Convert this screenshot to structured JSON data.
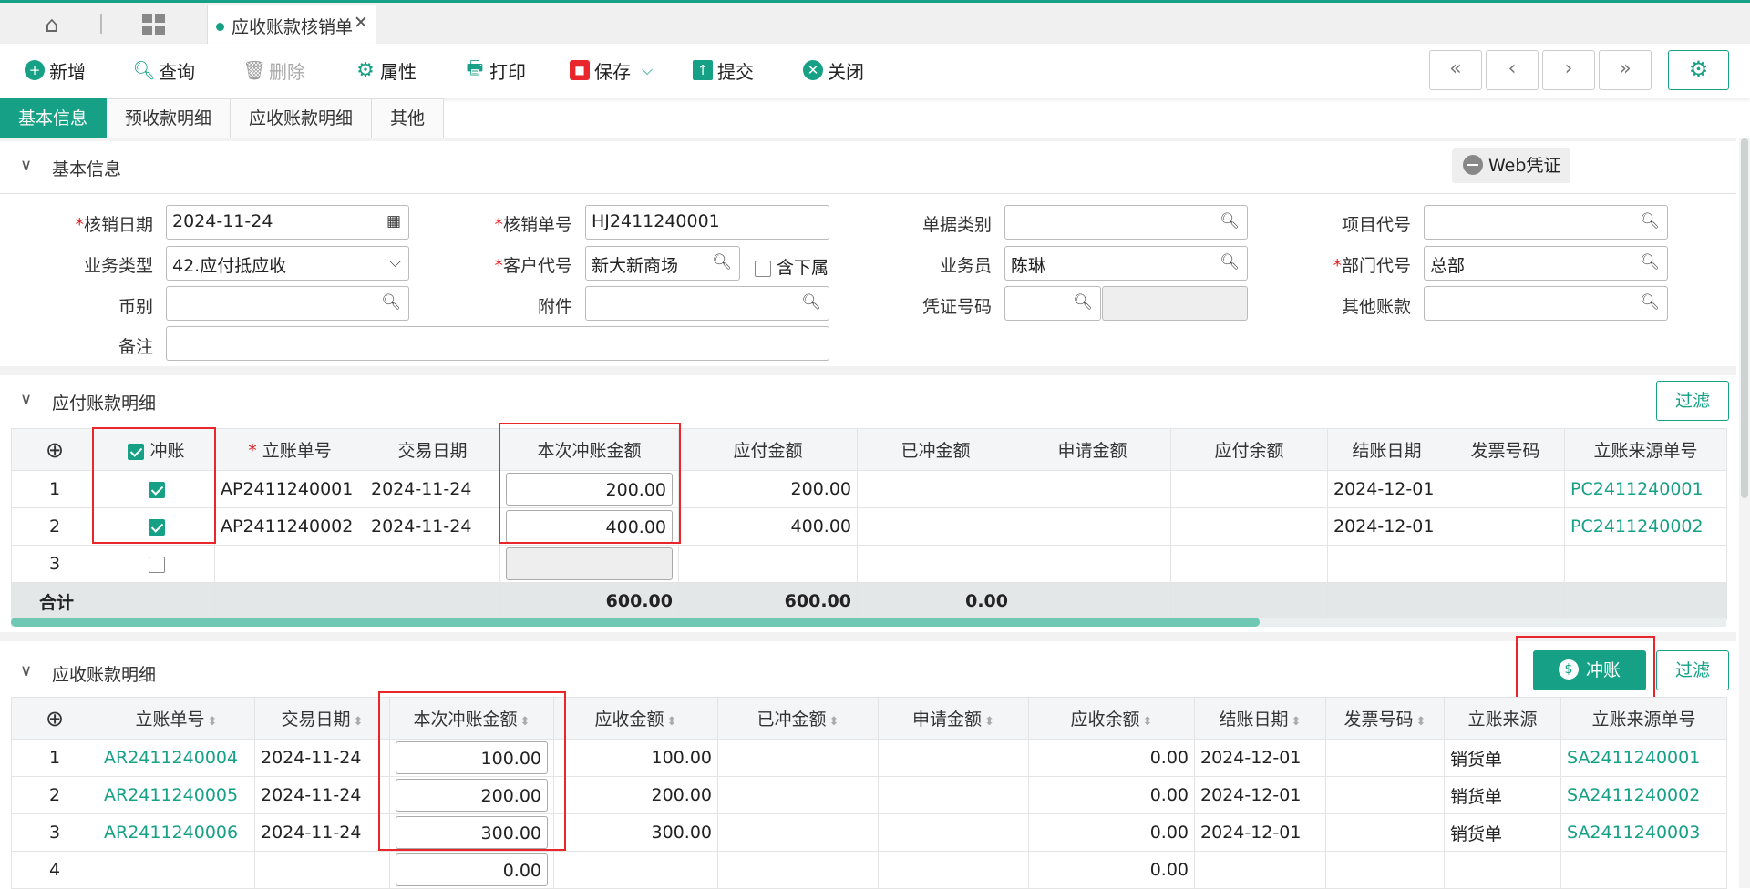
{
  "tabs_bar": {
    "doc_tab_label": "应收账款核销单"
  },
  "toolbar": {
    "new": "新增",
    "query": "查询",
    "delete": "删除",
    "props": "属性",
    "print": "打印",
    "save": "保存",
    "submit": "提交",
    "close": "关闭"
  },
  "nav": {
    "first": "«",
    "prev": "‹",
    "next": "›",
    "last": "»"
  },
  "page_tabs": [
    "基本信息",
    "预收款明细",
    "应收账款明细",
    "其他"
  ],
  "basic": {
    "section_title": "基本信息",
    "web_voucher": "Web凭证",
    "labels": {
      "date": "核销日期",
      "doc_no": "核销单号",
      "doc_type": "单据类别",
      "project": "项目代号",
      "biz_type": "业务类型",
      "customer": "客户代号",
      "include_sub": "含下属",
      "salesman": "业务员",
      "dept": "部门代号",
      "currency": "币别",
      "attachment": "附件",
      "voucher_no": "凭证号码",
      "other_acct": "其他账款",
      "remark": "备注"
    },
    "values": {
      "date": "2024-11-24",
      "doc_no": "HJ2411240001",
      "doc_type": "",
      "project": "",
      "biz_type": "42.应付抵应收",
      "customer": "新大新商场",
      "salesman": "陈琳",
      "dept": "总部",
      "currency": "",
      "attachment": "",
      "voucher_no": "",
      "other_acct": "",
      "remark": ""
    }
  },
  "payable": {
    "section_title": "应付账款明细",
    "filter": "过滤",
    "headers": [
      "冲账",
      "立账单号",
      "交易日期",
      "本次冲账金额",
      "应付金额",
      "已冲金额",
      "申请金额",
      "应付余额",
      "结账日期",
      "发票号码",
      "立账来源单号"
    ],
    "rows": [
      {
        "idx": "1",
        "doc": "AP2411240001",
        "date": "2024-11-24",
        "amount": "200.00",
        "payable": "200.00",
        "settled": "",
        "applied": "",
        "balance": "",
        "close_date": "2024-12-01",
        "invoice": "",
        "source": "PC2411240001"
      },
      {
        "idx": "2",
        "doc": "AP2411240002",
        "date": "2024-11-24",
        "amount": "400.00",
        "payable": "400.00",
        "settled": "",
        "applied": "",
        "balance": "",
        "close_date": "2024-12-01",
        "invoice": "",
        "source": "PC2411240002"
      },
      {
        "idx": "3",
        "doc": "",
        "date": "",
        "amount": "",
        "payable": "",
        "settled": "",
        "applied": "",
        "balance": "",
        "close_date": "",
        "invoice": "",
        "source": ""
      }
    ],
    "checked": [
      true,
      true,
      false
    ],
    "summary": {
      "label": "合计",
      "amount": "600.00",
      "payable": "600.00",
      "settled": "0.00"
    }
  },
  "receivable": {
    "section_title": "应收账款明细",
    "settle_btn": "冲账",
    "filter": "过滤",
    "headers": [
      "立账单号",
      "交易日期",
      "本次冲账金额",
      "应收金额",
      "已冲金额",
      "申请金额",
      "应收余额",
      "结账日期",
      "发票号码",
      "立账来源",
      "立账来源单号"
    ],
    "rows": [
      {
        "idx": "1",
        "doc": "AR2411240004",
        "date": "2024-11-24",
        "amount": "100.00",
        "recv": "100.00",
        "settled": "",
        "applied": "",
        "balance": "0.00",
        "close_date": "2024-12-01",
        "invoice": "",
        "src_type": "销货单",
        "source": "SA2411240001"
      },
      {
        "idx": "2",
        "doc": "AR2411240005",
        "date": "2024-11-24",
        "amount": "200.00",
        "recv": "200.00",
        "settled": "",
        "applied": "",
        "balance": "0.00",
        "close_date": "2024-12-01",
        "invoice": "",
        "src_type": "销货单",
        "source": "SA2411240002"
      },
      {
        "idx": "3",
        "doc": "AR2411240006",
        "date": "2024-11-24",
        "amount": "300.00",
        "recv": "300.00",
        "settled": "",
        "applied": "",
        "balance": "0.00",
        "close_date": "2024-12-01",
        "invoice": "",
        "src_type": "销货单",
        "source": "SA2411240003"
      },
      {
        "idx": "4",
        "doc": "",
        "date": "",
        "amount": "0.00",
        "recv": "",
        "settled": "",
        "applied": "",
        "balance": "0.00",
        "close_date": "",
        "invoice": "",
        "src_type": "",
        "source": ""
      }
    ]
  },
  "colors": {
    "accent": "#16a085",
    "highlight": "#e8262b"
  }
}
